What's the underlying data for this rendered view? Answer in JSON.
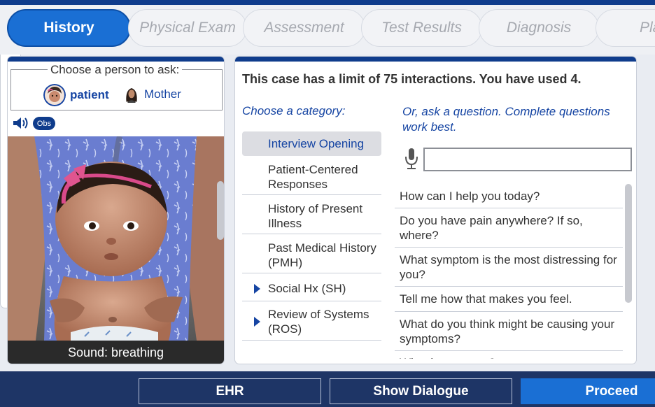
{
  "tabs": [
    {
      "label": "History",
      "active": true
    },
    {
      "label": "Physical Exam"
    },
    {
      "label": "Assessment"
    },
    {
      "label": "Test Results"
    },
    {
      "label": "Diagnosis"
    },
    {
      "label": "Pla"
    }
  ],
  "left": {
    "ask_label": "Choose a person to ask:",
    "people": [
      {
        "name": "patient",
        "selected": true
      },
      {
        "name": "Mother"
      }
    ],
    "obs_label": "Obs",
    "sound_label": "Sound: breathing"
  },
  "center": {
    "limit_text": "This case has a limit of 75 interactions. You have used 4.",
    "category_heading": "Choose a category:",
    "question_heading": "Or, ask a question. Complete questions work best.",
    "categories": [
      {
        "label": "Interview Opening",
        "selected": true
      },
      {
        "label": "Patient-Centered Responses"
      },
      {
        "label": "History of Present Illness"
      },
      {
        "label": "Past Medical History (PMH)"
      },
      {
        "label": "Social Hx (SH)",
        "expandable": true
      },
      {
        "label": "Review of Systems (ROS)",
        "expandable": true
      }
    ],
    "questions": [
      "How can I help you today?",
      "Do you have pain anywhere? If so, where?",
      "What symptom is the most distressing for you?",
      "Tell me how that makes you feel.",
      "What do you think might be causing your symptoms?",
      "What is your age?"
    ]
  },
  "bottom": {
    "ehr_label": "EHR",
    "dialogue_label": "Show Dialogue",
    "proceed_label": "Proceed"
  },
  "colors": {
    "primary": "#1a6fd4",
    "navy": "#0f3c8c",
    "bottom_bar": "#1e3566",
    "link_text": "#1645a3"
  }
}
